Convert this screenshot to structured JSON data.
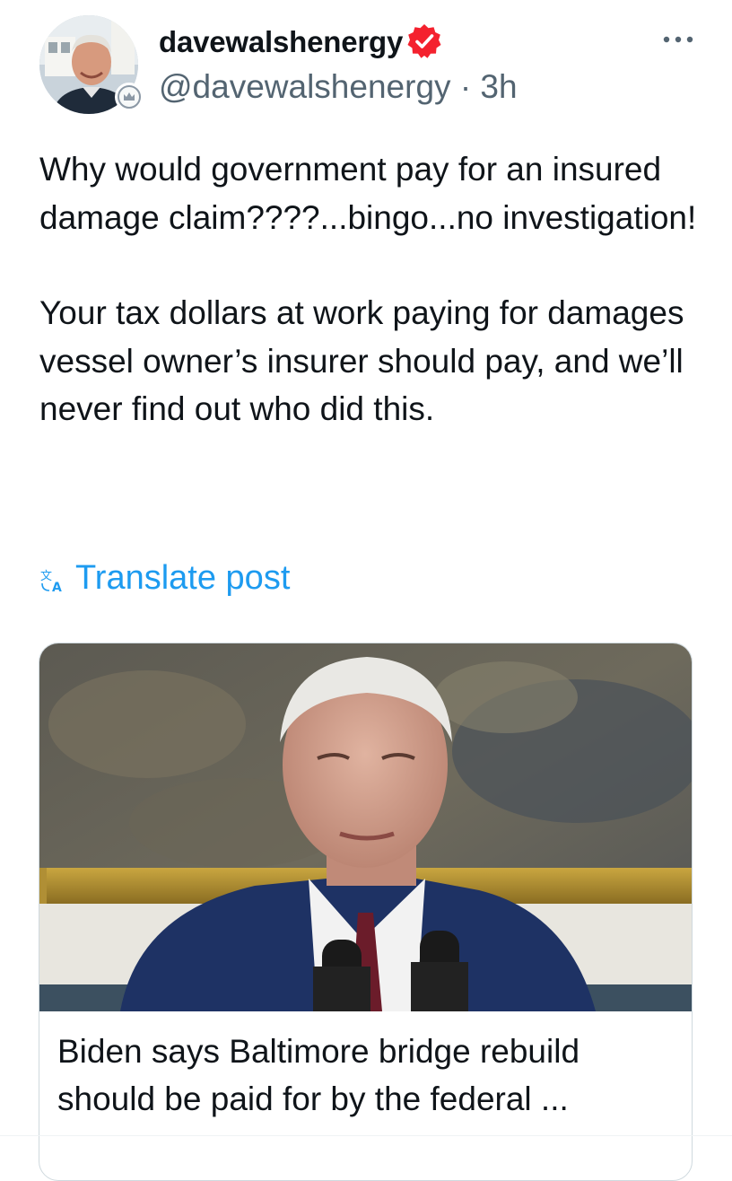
{
  "author": {
    "display_name": "davewalshenergy",
    "handle": "@davewalshenergy",
    "separator": "·",
    "time": "3h",
    "verified_color": "#f4212e",
    "avatar_icon": "profile-photo",
    "badge_icon": "affiliate-badge-icon"
  },
  "menu": {
    "icon": "more-horizontal-icon"
  },
  "post": {
    "paragraph_1": "Why would government pay for an insured damage claim????...bingo...no investigation!",
    "paragraph_2": "Your tax dollars at work paying for damages vessel owner’s insurer should pay, and we’ll never find out who did this."
  },
  "translate": {
    "label": "Translate post",
    "icon": "translate-icon"
  },
  "link_card": {
    "image": "photo of speaker at podium",
    "title_line_1": "Biden says Baltimore bridge rebuild",
    "title_line_2": "should be paid for by the federal ..."
  },
  "colors": {
    "accent": "#1d9bf0",
    "text": "#0f1419",
    "secondary_text": "#536471",
    "verified": "#f4212e"
  }
}
